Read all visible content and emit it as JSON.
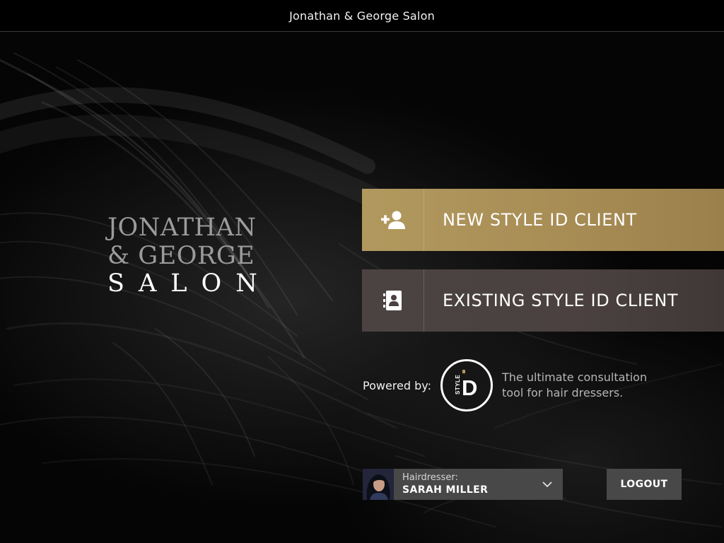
{
  "app": {
    "title": "Jonathan & George Salon"
  },
  "logo": {
    "line1": "JONATHAN",
    "line2": "& GEORGE",
    "line3": "SALON"
  },
  "actions": {
    "new_client": {
      "label": "NEW STYLE ID CLIENT",
      "icon": "add-user-icon"
    },
    "existing_client": {
      "label": "EXISTING STYLE ID CLIENT",
      "icon": "contacts-book-icon"
    }
  },
  "powered_by": {
    "label": "Powered by:",
    "logo_text": "STYLE",
    "logo_letter": "D",
    "tagline_line1": "The ultimate consultation",
    "tagline_line2": "tool for hair dressers."
  },
  "hairdresser": {
    "label": "Hairdresser:",
    "name": "SARAH MILLER",
    "icon": "chevron-down-icon"
  },
  "logout": {
    "label": "LOGOUT"
  },
  "colors": {
    "gold_button": "#ab9157",
    "brown_button": "#4a4140",
    "gray_control": "#484848",
    "topbar": "#000000"
  }
}
